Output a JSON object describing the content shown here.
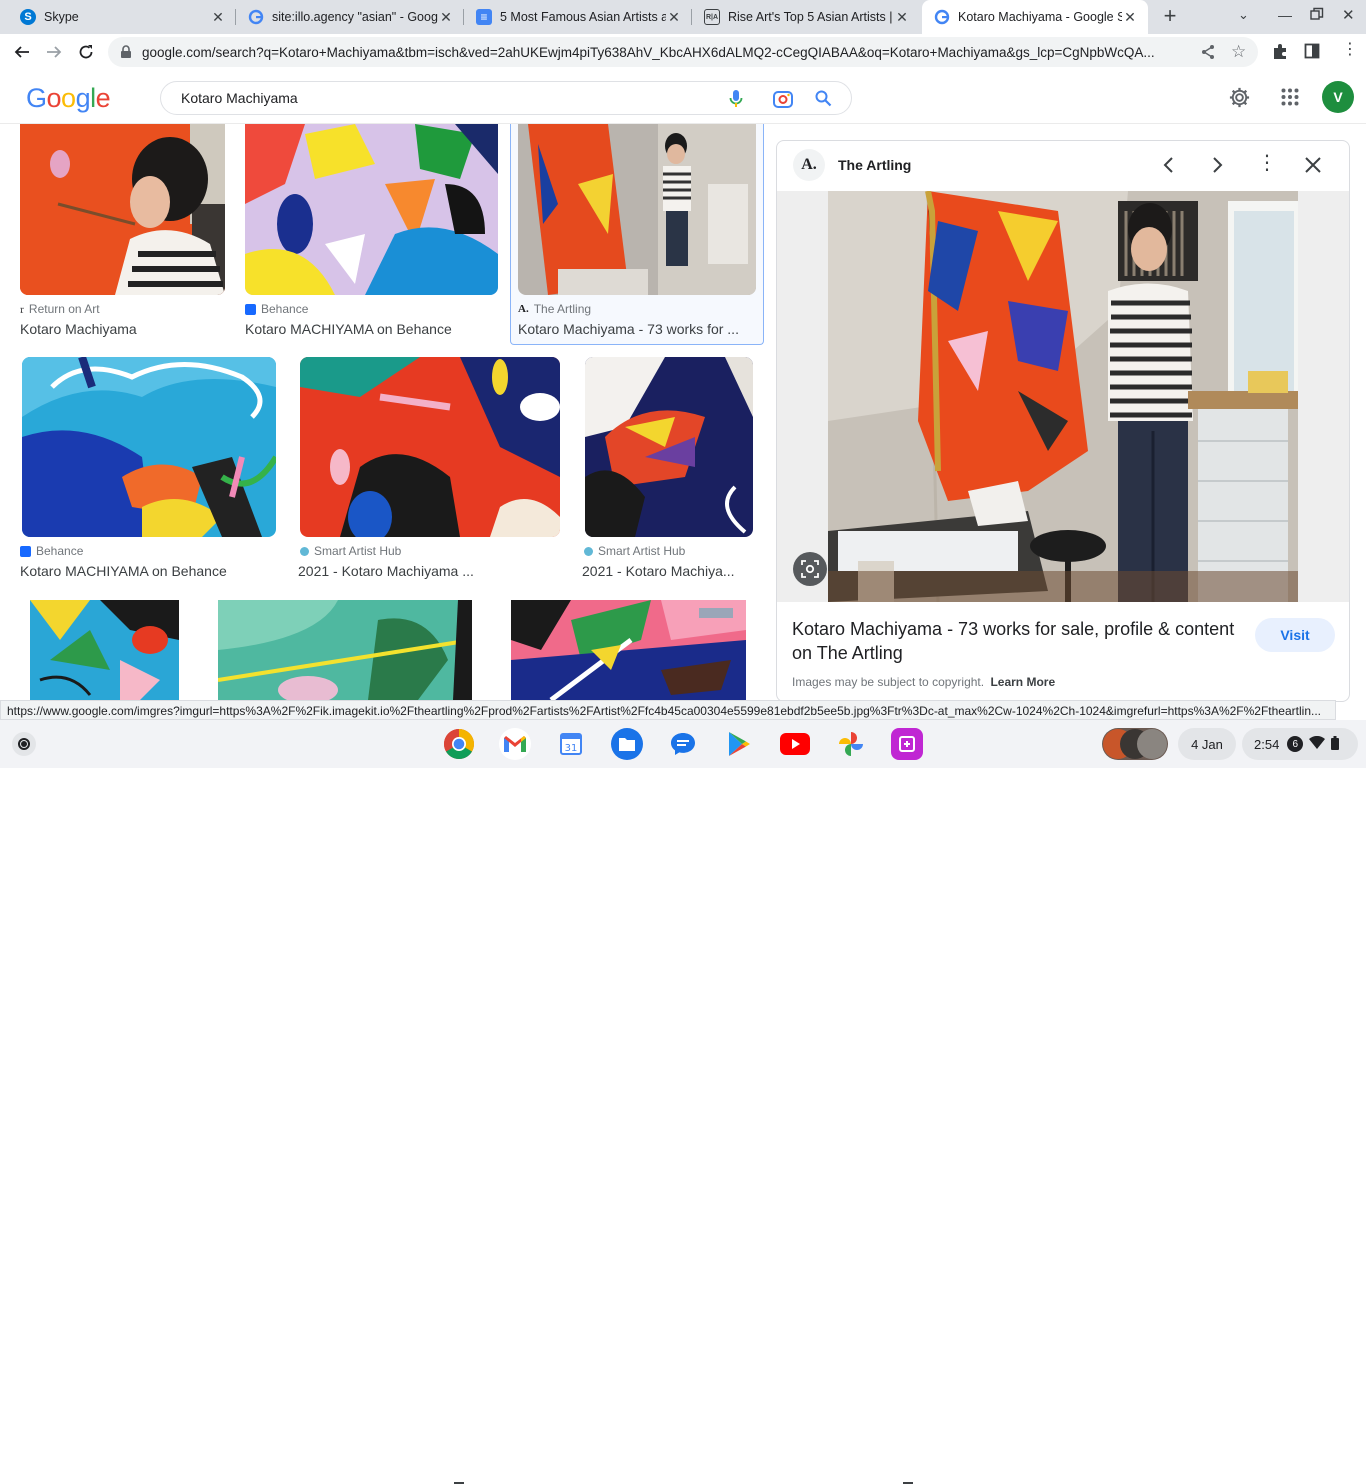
{
  "tabs": [
    {
      "title": "Skype",
      "fav_text": "S",
      "fav_color": "#0078d4"
    },
    {
      "title": "site:illo.agency \"asian\" - Googl",
      "fav_text": "G",
      "fav_color": "#ffffff"
    },
    {
      "title": "5 Most Famous Asian Artists a",
      "fav_text": "≡",
      "fav_color": "#4285f4"
    },
    {
      "title": "Rise Art's Top 5 Asian Artists |",
      "fav_text": "R|A",
      "fav_color": "#ffffff"
    },
    {
      "title": "Kotaro Machiyama - Google S",
      "fav_text": "G",
      "fav_color": "#ffffff"
    }
  ],
  "toolbar": {
    "url": "google.com/search?q=Kotaro+Machiyama&tbm=isch&ved=2ahUKEwjm4piTy638AhV_KbcAHX6dALMQ2-cCegQIABAA&oq=Kotaro+Machiyama&gs_lcp=CgNpbWcQA..."
  },
  "google": {
    "logo_letters": [
      "G",
      "o",
      "o",
      "g",
      "l",
      "e"
    ],
    "logo_colors": [
      "#4285f4",
      "#ea4335",
      "#fbbc05",
      "#4285f4",
      "#34a853",
      "#ea4335"
    ],
    "query": "Kotaro Machiyama",
    "avatar_letter": "V"
  },
  "results": [
    {
      "source": "Return on Art",
      "title": "Kotaro Machiyama"
    },
    {
      "source": "Behance",
      "title": "Kotaro MACHIYAMA on Behance"
    },
    {
      "source": "The Artling",
      "title": "Kotaro Machiyama - 73 works for ..."
    },
    {
      "source": "Behance",
      "title": "Kotaro MACHIYAMA on Behance"
    },
    {
      "source": "Smart Artist Hub",
      "title": "2021 - Kotaro Machiyama ..."
    },
    {
      "source": "Smart Artist Hub",
      "title": "2021 - Kotaro Machiya..."
    }
  ],
  "panel": {
    "site_letter": "A.",
    "site_name": "The Artling",
    "title": "Kotaro Machiyama - 73 works for sale, profile & content on The Artling",
    "visit_label": "Visit",
    "copyright": "Images may be subject to copyright.",
    "learn_more": "Learn More"
  },
  "status_url": "https://www.google.com/imgres?imgurl=https%3A%2F%2Fik.imagekit.io%2Ftheartling%2Fprod%2Fartists%2FArtist%2Ffc4b45ca00304e5599e81ebdf2b5ee5b.jpg%3Ftr%3Dc-at_max%2Cw-1024%2Ch-1024&imgrefurl=https%3A%2F%2Ftheartlin...",
  "shelf": {
    "date": "4 Jan",
    "time": "2:54",
    "notif_count": "6"
  }
}
